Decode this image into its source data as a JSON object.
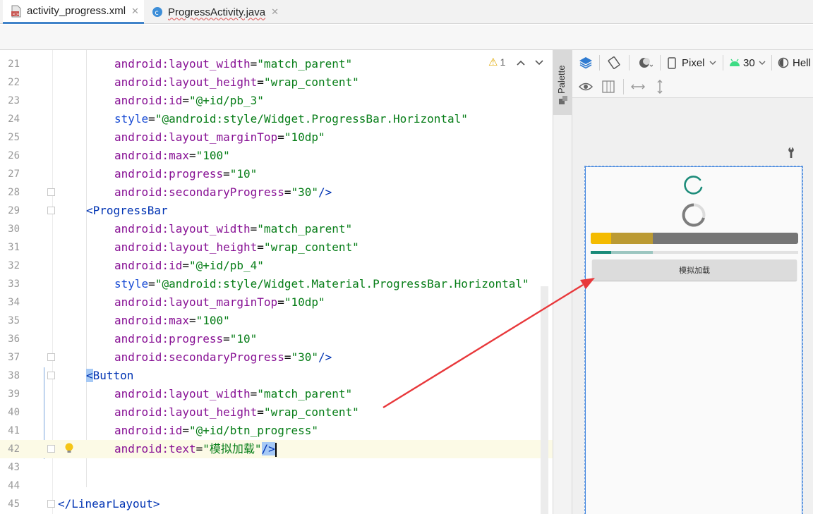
{
  "tabs": [
    {
      "label": "activity_progress.xml",
      "active": true,
      "icon": "xml-file-icon"
    },
    {
      "label": "ProgressActivity.java",
      "active": false,
      "icon": "java-class-icon"
    }
  ],
  "inspection": {
    "warnings": "1"
  },
  "editor": {
    "lines": [
      {
        "n": "21"
      },
      {
        "n": "22"
      },
      {
        "n": "23"
      },
      {
        "n": "24"
      },
      {
        "n": "25"
      },
      {
        "n": "26"
      },
      {
        "n": "27"
      },
      {
        "n": "28"
      },
      {
        "n": "29"
      },
      {
        "n": "30"
      },
      {
        "n": "31"
      },
      {
        "n": "32"
      },
      {
        "n": "33"
      },
      {
        "n": "34"
      },
      {
        "n": "35"
      },
      {
        "n": "36"
      },
      {
        "n": "37"
      },
      {
        "n": "38"
      },
      {
        "n": "39"
      },
      {
        "n": "40"
      },
      {
        "n": "41"
      },
      {
        "n": "42"
      },
      {
        "n": "43"
      },
      {
        "n": "44"
      },
      {
        "n": "45"
      }
    ],
    "code": {
      "l21": {
        "ns": "android:",
        "name": "layout_width",
        "value": "\"match_parent\""
      },
      "l22": {
        "ns": "android:",
        "name": "layout_height",
        "value": "\"wrap_content\""
      },
      "l23": {
        "ns": "android:",
        "name": "id",
        "value": "\"@+id/pb_3\""
      },
      "l24": {
        "name": "style",
        "value": "\"@android:style/Widget.ProgressBar.Horizontal\""
      },
      "l25": {
        "ns": "android:",
        "name": "layout_marginTop",
        "value": "\"10dp\""
      },
      "l26": {
        "ns": "android:",
        "name": "max",
        "value": "\"100\""
      },
      "l27": {
        "ns": "android:",
        "name": "progress",
        "value": "\"10\""
      },
      "l28": {
        "ns": "android:",
        "name": "secondaryProgress",
        "value": "\"30\"",
        "end": "/>"
      },
      "l29": {
        "open": "<",
        "tag": "ProgressBar"
      },
      "l30": {
        "ns": "android:",
        "name": "layout_width",
        "value": "\"match_parent\""
      },
      "l31": {
        "ns": "android:",
        "name": "layout_height",
        "value": "\"wrap_content\""
      },
      "l32": {
        "ns": "android:",
        "name": "id",
        "value": "\"@+id/pb_4\""
      },
      "l33": {
        "name": "style",
        "value": "\"@android:style/Widget.Material.ProgressBar.Horizontal\""
      },
      "l34": {
        "ns": "android:",
        "name": "layout_marginTop",
        "value": "\"10dp\""
      },
      "l35": {
        "ns": "android:",
        "name": "max",
        "value": "\"100\""
      },
      "l36": {
        "ns": "android:",
        "name": "progress",
        "value": "\"10\""
      },
      "l37": {
        "ns": "android:",
        "name": "secondaryProgress",
        "value": "\"30\"",
        "end": "/>"
      },
      "l38": {
        "open": "<",
        "tag": "Button"
      },
      "l39": {
        "ns": "android:",
        "name": "layout_width",
        "value": "\"match_parent\""
      },
      "l40": {
        "ns": "android:",
        "name": "layout_height",
        "value": "\"wrap_content\""
      },
      "l41": {
        "ns": "android:",
        "name": "id",
        "value": "\"@+id/btn_progress\""
      },
      "l42": {
        "ns": "android:",
        "name": "text",
        "value": "\"模拟加载\"",
        "end": "/>"
      },
      "l45": {
        "open": "</",
        "tag": "LinearLayout",
        "close": ">"
      }
    }
  },
  "palette": {
    "label": "Palette"
  },
  "design": {
    "device": "Pixel",
    "api": "30",
    "theme": "Hell",
    "preview": {
      "progress_big": {
        "progress": 0.1,
        "secondary": 0.3
      },
      "progress_thin": {
        "progress": 0.1,
        "secondary": 0.3
      },
      "button_label": "模拟加载"
    }
  },
  "colors": {
    "accent": "#4083c9",
    "arrow": "#e8383b",
    "bar_primary": "#f4bb00",
    "bar_secondary": "#bb9a33",
    "material_teal": "#198a78"
  }
}
